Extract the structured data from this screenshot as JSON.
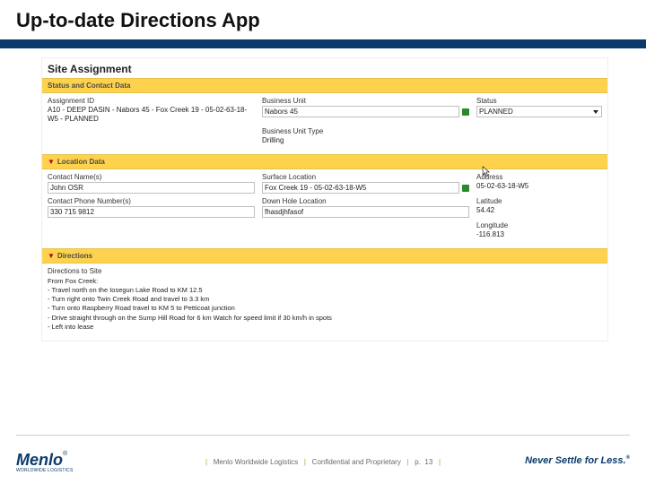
{
  "slide_title": "Up-to-date Directions App",
  "page_heading": "Site Assignment",
  "sections": {
    "status": {
      "title": "Status and Contact Data"
    },
    "location": {
      "title": "Location Data"
    },
    "directions": {
      "title": "Directions"
    }
  },
  "status": {
    "assignment_id_label": "Assignment ID",
    "assignment_id_value": "A10 - DEEP DASIN - Nabors 45 - Fox Creek 19 - 05-02-63-18-W5 - PLANNED",
    "business_unit_label": "Business Unit",
    "business_unit_value": "Nabors 45",
    "status_label": "Status",
    "status_value": "PLANNED",
    "business_unit_type_label": "Business Unit Type",
    "business_unit_type_value": "Drilling"
  },
  "location": {
    "contact_names_label": "Contact Name(s)",
    "contact_names_value": "John OSR",
    "surface_location_label": "Surface Location",
    "surface_location_value": "Fox Creek 19 - 05-02-63-18-W5",
    "address_label": "Address",
    "address_value": "05-02-63-18-W5",
    "contact_phone_label": "Contact Phone Number(s)",
    "contact_phone_value": "330 715 9812",
    "down_hole_label": "Down Hole Location",
    "down_hole_value": "fhasdjhfasof",
    "latitude_label": "Latitude",
    "latitude_value": "54.42",
    "longitude_label": "Longitude",
    "longitude_value": "-116.813"
  },
  "directions": {
    "label": "Directions to Site",
    "text": "From Fox Creek:\n- Travel north on the Iosegun Lake Road to KM 12.5\n- Turn right onto Twin Creek Road and travel to 3.3 km\n- Turn onto Raspberry Road travel to KM 5 to Petticoat junction\n- Drive straight through on the Sump Hill Road for 6 km Watch for speed limit if 30 km/h in spots\n- Left into lease"
  },
  "footer": {
    "brand": "Menlo Worldwide Logistics",
    "confidential": "Confidential and Proprietary",
    "page_label": "p.",
    "page_num": "13",
    "sep": "|"
  },
  "logo": {
    "name": "Menlo",
    "sub": "WORLDWIDE LOGISTICS"
  },
  "tagline": "Never Settle for Less."
}
